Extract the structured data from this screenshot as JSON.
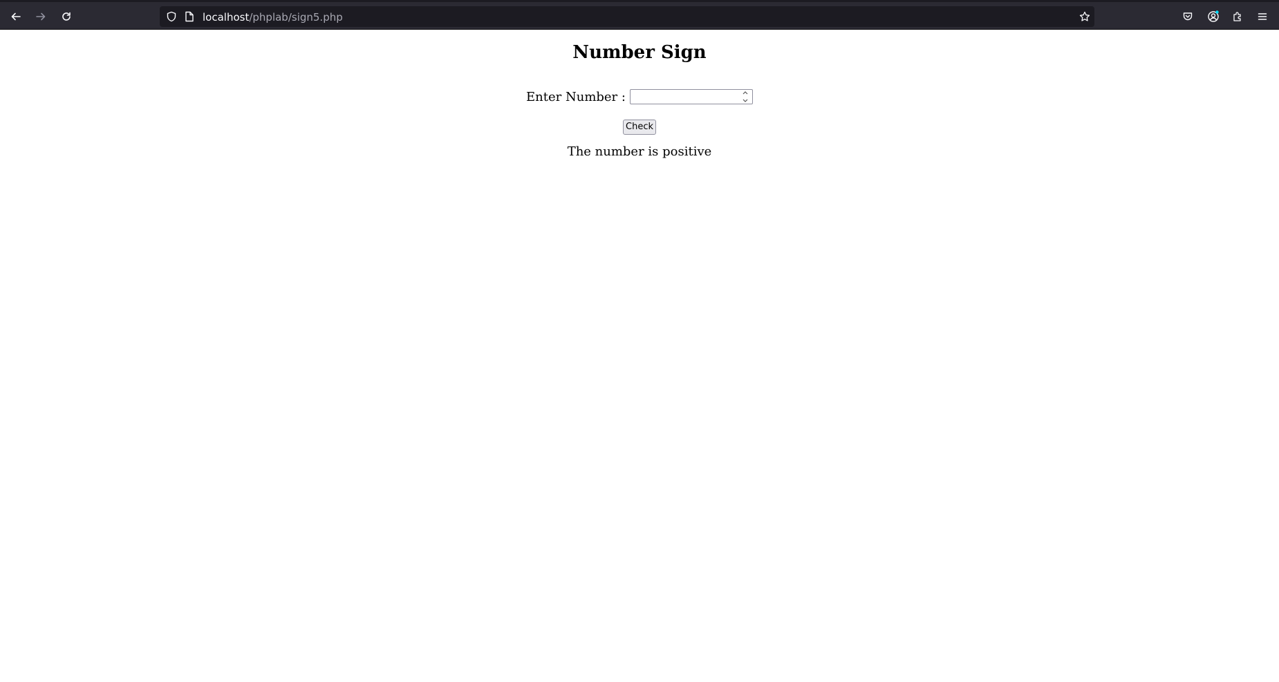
{
  "browser": {
    "url_host": "localhost",
    "url_path": "/phplab/sign5.php",
    "icons": [
      "back-icon",
      "forward-icon",
      "reload-icon",
      "shield-icon",
      "page-icon",
      "star-icon",
      "pocket-icon",
      "account-icon",
      "extensions-icon",
      "menu-icon"
    ]
  },
  "page": {
    "title": "Number Sign",
    "input_label": "Enter Number :",
    "input_value": "",
    "button_label": "Check",
    "result": "The number is positive"
  }
}
